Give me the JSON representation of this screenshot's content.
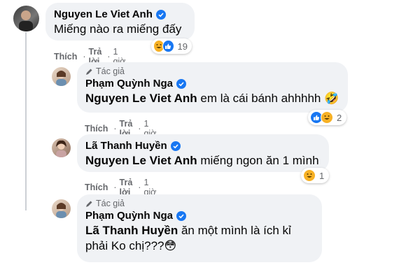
{
  "comments": [
    {
      "author": "Nguyen Le Viet Anh",
      "author_tag": "",
      "mention": "",
      "text": "Miếng nào ra miếng đấy",
      "actions": {
        "like": "Thích",
        "reply": "Trả lời",
        "time": "1 giờ"
      },
      "reaction_count": "19"
    },
    {
      "author": "Phạm Quỳnh Nga",
      "author_tag": "Tác giả",
      "mention": "Nguyen Le Viet Anh",
      "text": " em là cái bánh ahhhhh 🤣",
      "actions": {
        "like": "Thích",
        "reply": "Trả lời",
        "time": "1 giờ"
      },
      "reaction_count": "2"
    },
    {
      "author": "Lã Thanh Huyền",
      "author_tag": "",
      "mention": "Nguyen Le Viet Anh",
      "text": " miếng ngon ăn 1 mình",
      "actions": {
        "like": "Thích",
        "reply": "Trả lời",
        "time": "1 giờ"
      },
      "reaction_count": "1"
    },
    {
      "author": "Phạm Quỳnh Nga",
      "author_tag": "Tác giả",
      "mention": "Lã Thanh Huyền",
      "text": " ăn một mình là ích kỉ phải Ko chị???😳",
      "actions": {
        "like": "",
        "reply": "",
        "time": ""
      },
      "reaction_count": ""
    }
  ],
  "icons": {
    "verified": "verified-badge-icon",
    "author_tag": "pencil-icon",
    "haha": "haha-reaction-icon",
    "like": "like-reaction-icon"
  },
  "colors": {
    "accent": "#1877f2",
    "bubble": "#f0f2f5",
    "muted": "#65676b"
  }
}
